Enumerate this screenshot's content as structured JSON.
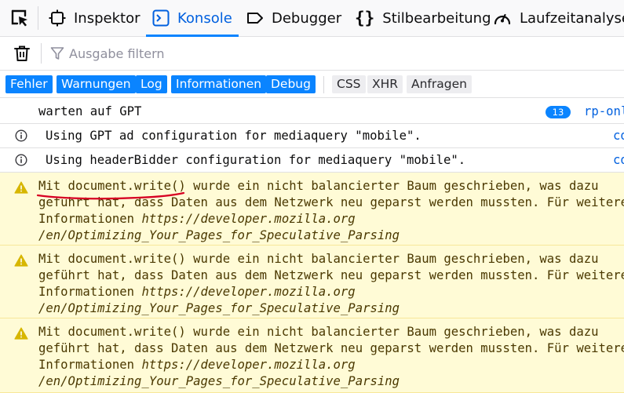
{
  "tabs": [
    {
      "label": "Inspektor",
      "icon": "inspector-icon",
      "selected": false
    },
    {
      "label": "Konsole",
      "icon": "console-icon",
      "selected": true
    },
    {
      "label": "Debugger",
      "icon": "debugger-icon",
      "selected": false
    },
    {
      "label": "Stilbearbeitung",
      "icon": "style-editor-icon",
      "selected": false
    },
    {
      "label": "Laufzeitanalyse",
      "icon": "performance-icon",
      "selected": false
    }
  ],
  "filter": {
    "placeholder": "Ausgabe filtern",
    "value": ""
  },
  "levels": [
    {
      "label": "Fehler",
      "active": true
    },
    {
      "label": "Warnungen",
      "active": true
    },
    {
      "label": "Log",
      "active": true
    },
    {
      "label": "Informationen",
      "active": true
    },
    {
      "label": "Debug",
      "active": true
    }
  ],
  "requests": [
    {
      "label": "CSS",
      "active": false
    },
    {
      "label": "XHR",
      "active": false
    },
    {
      "label": "Anfragen",
      "active": false
    }
  ],
  "messages": [
    {
      "type": "log",
      "text": "warten auf GPT",
      "repeat": "13",
      "source": "rp-onl"
    },
    {
      "type": "info",
      "text": "Using GPT ad configuration for mediaquery \"mobile\".",
      "source": "co"
    },
    {
      "type": "info",
      "text": "Using headerBidder configuration for mediaquery \"mobile\".",
      "source": "co"
    },
    {
      "type": "warn",
      "lines": [
        "Mit document.write() wurde ein nicht balancierter Baum geschrieben, was dazu",
        "geführt hat, dass Daten aus dem Netzwerk neu geparst werden mussten. Für weitere",
        "Informationen "
      ],
      "link": "https://developer.mozilla.org",
      "link2": "/en/Optimizing_Your_Pages_for_Speculative_Parsing"
    },
    {
      "type": "warn",
      "lines": [
        "Mit document.write() wurde ein nicht balancierter Baum geschrieben, was dazu",
        "geführt hat, dass Daten aus dem Netzwerk neu geparst werden mussten. Für weitere",
        "Informationen "
      ],
      "link": "https://developer.mozilla.org",
      "link2": "/en/Optimizing_Your_Pages_for_Speculative_Parsing"
    },
    {
      "type": "warn",
      "lines": [
        "Mit document.write() wurde ein nicht balancierter Baum geschrieben, was dazu",
        "geführt hat, dass Daten aus dem Netzwerk neu geparst werden mussten. Für weitere",
        "Informationen "
      ],
      "link": "https://developer.mozilla.org",
      "link2": "/en/Optimizing_Your_Pages_for_Speculative_Parsing"
    }
  ],
  "colors": {
    "accent": "#0a84ff",
    "selected_tab_text": "#0060df",
    "warning_bg": "#fffbd6",
    "warning_icon": "#d7b600",
    "annotation": "#d70022"
  }
}
